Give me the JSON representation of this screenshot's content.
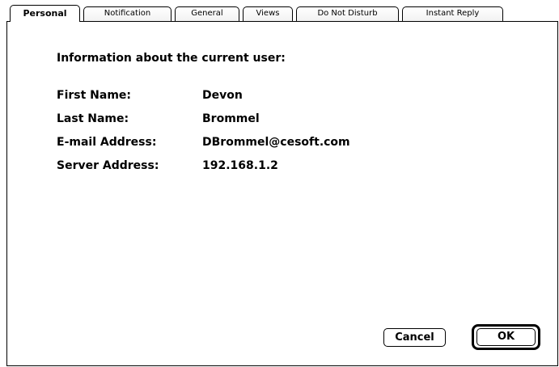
{
  "tabs": [
    {
      "label": "Personal",
      "active": true
    },
    {
      "label": "Notification",
      "active": false
    },
    {
      "label": "General",
      "active": false
    },
    {
      "label": "Views",
      "active": false
    },
    {
      "label": "Do Not Disturb",
      "active": false
    },
    {
      "label": "Instant Reply",
      "active": false
    }
  ],
  "personal": {
    "heading": "Information about the current user:",
    "fields": [
      {
        "label": "First Name:",
        "value": "Devon"
      },
      {
        "label": "Last Name:",
        "value": "Brommel"
      },
      {
        "label": "E-mail Address:",
        "value": "DBrommel@cesoft.com"
      },
      {
        "label": "Server Address:",
        "value": "192.168.1.2"
      }
    ]
  },
  "buttons": {
    "cancel_label": "Cancel",
    "ok_label": "OK"
  }
}
